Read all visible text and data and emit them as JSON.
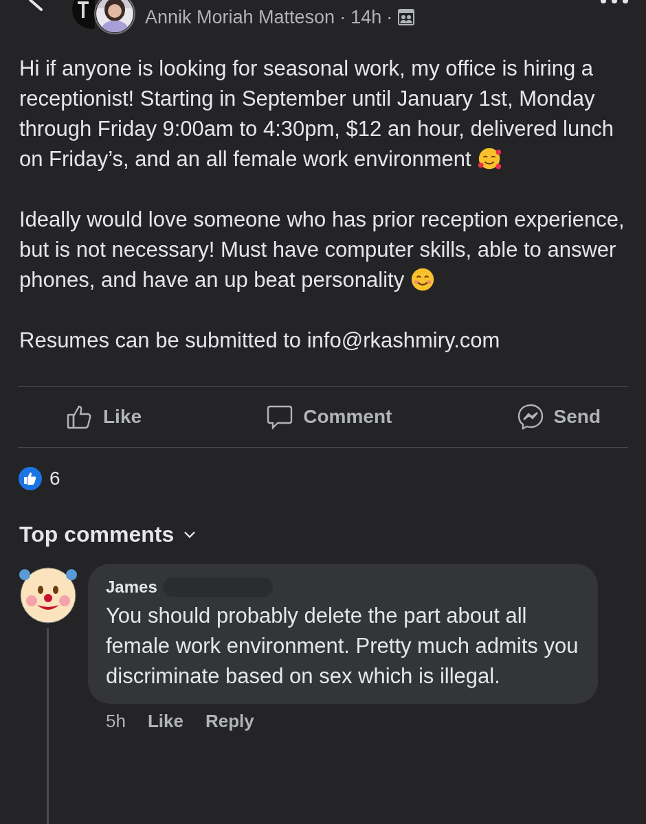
{
  "post": {
    "author": "Annik Moriah Matteson",
    "separator_1": "·",
    "time": "14h",
    "separator_2": "·",
    "paragraphs": [
      {
        "text": "Hi if anyone is looking for seasonal work, my office is hiring a receptionist! Starting in September until January 1st, Monday through Friday 9:00am to 4:30pm, $12 an hour, delivered lunch on Friday’s, and an all female work environment",
        "emoji": {
          "kind": "hearts"
        }
      },
      {
        "text": "Ideally would love someone who has prior reception experience, but is not necessary! Must have computer skills, able to answer phones, and have an up beat personality",
        "emoji": {
          "kind": "smile"
        }
      },
      {
        "text": "Resumes can be submitted to info@rkashmiry.com"
      }
    ]
  },
  "actions": [
    {
      "kind": "like",
      "label": "Like"
    },
    {
      "kind": "comment",
      "label": "Comment"
    },
    {
      "kind": "send",
      "label": "Send"
    }
  ],
  "reactions": {
    "count": "6"
  },
  "comments_header": {
    "label": "Top comments"
  },
  "comments": [
    {
      "author": "James",
      "redacted": true,
      "text": "You should probably delete the part about all female work environment. Pretty much admits you discriminate based on sex which is illegal.",
      "time": "5h",
      "like": "Like",
      "reply": "Reply"
    }
  ]
}
